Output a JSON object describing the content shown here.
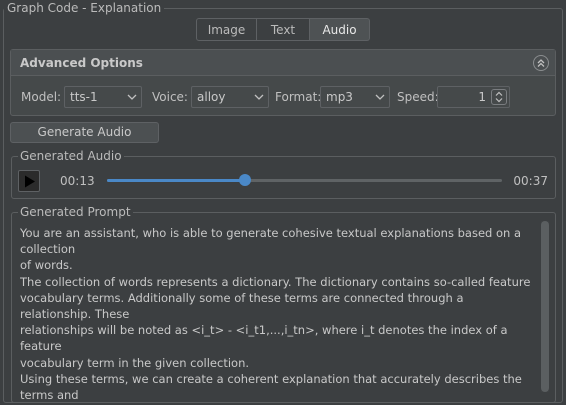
{
  "window": {
    "group_title": "Graph Code - Explanation"
  },
  "tabs": [
    {
      "label": "Image"
    },
    {
      "label": "Text"
    },
    {
      "label": "Audio"
    }
  ],
  "advanced": {
    "title": "Advanced Options",
    "model_label": "Model:",
    "model_value": "tts-1",
    "voice_label": "Voice:",
    "voice_value": "alloy",
    "format_label": "Format:",
    "format_value": "mp3",
    "speed_label": "Speed:",
    "speed_value": "1"
  },
  "generate_button": "Generate Audio",
  "audio": {
    "title": "Generated Audio",
    "current_time": "00:13",
    "total_time": "00:37",
    "progress": 0.35
  },
  "prompt": {
    "title": "Generated Prompt",
    "text": "You are an assistant, who is able to generate cohesive textual explanations based on a collection\nof words.\nThe collection of words represents a dictionary. The dictionary contains so-called feature\nvocabulary terms. Additionally some of these terms are connected through a relationship. These\nrelationships will be noted as <i_t> - <i_t1,...,i_tn>, where i_t denotes the index of a feature\nvocabulary term in the given collection.\nUsing these terms, we can create a coherent explanation that accurately describes the terms and\nits relations.\n\nAn example could be: The image shows water, the sky, and clouds. We can imagine a scene with\nclouds floating in the sky above."
  },
  "colors": {
    "accent": "#4a88c7",
    "background": "#3c3f41"
  }
}
